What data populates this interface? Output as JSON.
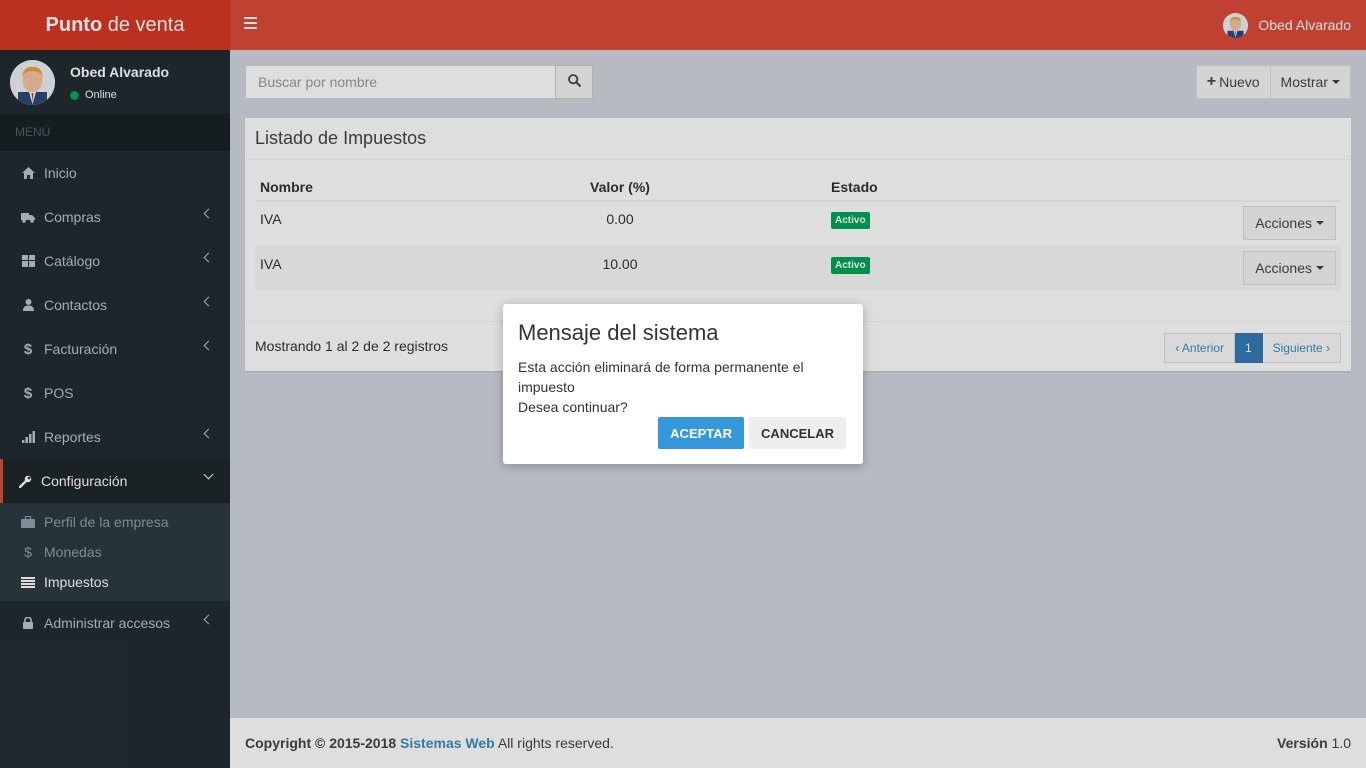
{
  "header": {
    "brand_bold": "Punto",
    "brand_rest": " de venta",
    "user_name": "Obed Alvarado"
  },
  "sidebar": {
    "user_name": "Obed Alvarado",
    "user_status": "Online",
    "menu_header": "MENÚ",
    "items": [
      {
        "label": "Inicio",
        "icon": "home-icon"
      },
      {
        "label": "Compras",
        "icon": "truck-icon"
      },
      {
        "label": "Catálogo",
        "icon": "grid-icon"
      },
      {
        "label": "Contactos",
        "icon": "user-icon"
      },
      {
        "label": "Facturación",
        "icon": "dollar-icon"
      },
      {
        "label": "POS",
        "icon": "dollar-icon"
      },
      {
        "label": "Reportes",
        "icon": "bar-chart-icon"
      },
      {
        "label": "Configuración",
        "icon": "wrench-icon"
      },
      {
        "label": "Administrar accesos",
        "icon": "lock-icon"
      }
    ],
    "submenu": [
      {
        "label": "Perfil de la empresa",
        "icon": "briefcase-icon"
      },
      {
        "label": "Monedas",
        "icon": "dollar-icon"
      },
      {
        "label": "Impuestos",
        "icon": "list-icon"
      }
    ]
  },
  "search": {
    "placeholder": "Buscar por nombre"
  },
  "toolbar": {
    "new_label": "Nuevo",
    "show_label": "Mostrar"
  },
  "box": {
    "title": "Listado de Impuestos",
    "columns": [
      "Nombre",
      "Valor (%)",
      "Estado"
    ],
    "rows": [
      {
        "nombre": "IVA",
        "valor": "0.00",
        "estado": "Activo",
        "action": "Acciones"
      },
      {
        "nombre": "IVA",
        "valor": "10.00",
        "estado": "Activo",
        "action": "Acciones"
      }
    ],
    "showing": "Mostrando 1 al 2 de 2 registros",
    "pagination": {
      "prev": "‹ Anterior",
      "current": "1",
      "next": "Siguiente ›"
    }
  },
  "footer": {
    "copyright": "Copyright © 2015-2018",
    "company": "Sistemas Web",
    "rights": "All rights reserved.",
    "version_label": "Versión",
    "version_value": "1.0"
  },
  "modal": {
    "title": "Mensaje del sistema",
    "line1": "Esta acción eliminará de forma permanente el impuesto",
    "line2": "Desea continuar?",
    "accept": "ACEPTAR",
    "cancel": "CANCELAR"
  },
  "colors": {
    "header": "#dd4b39",
    "brand": "#d73925",
    "sidebar": "#222d32",
    "accent": "#3498db",
    "success": "#00a65a"
  }
}
